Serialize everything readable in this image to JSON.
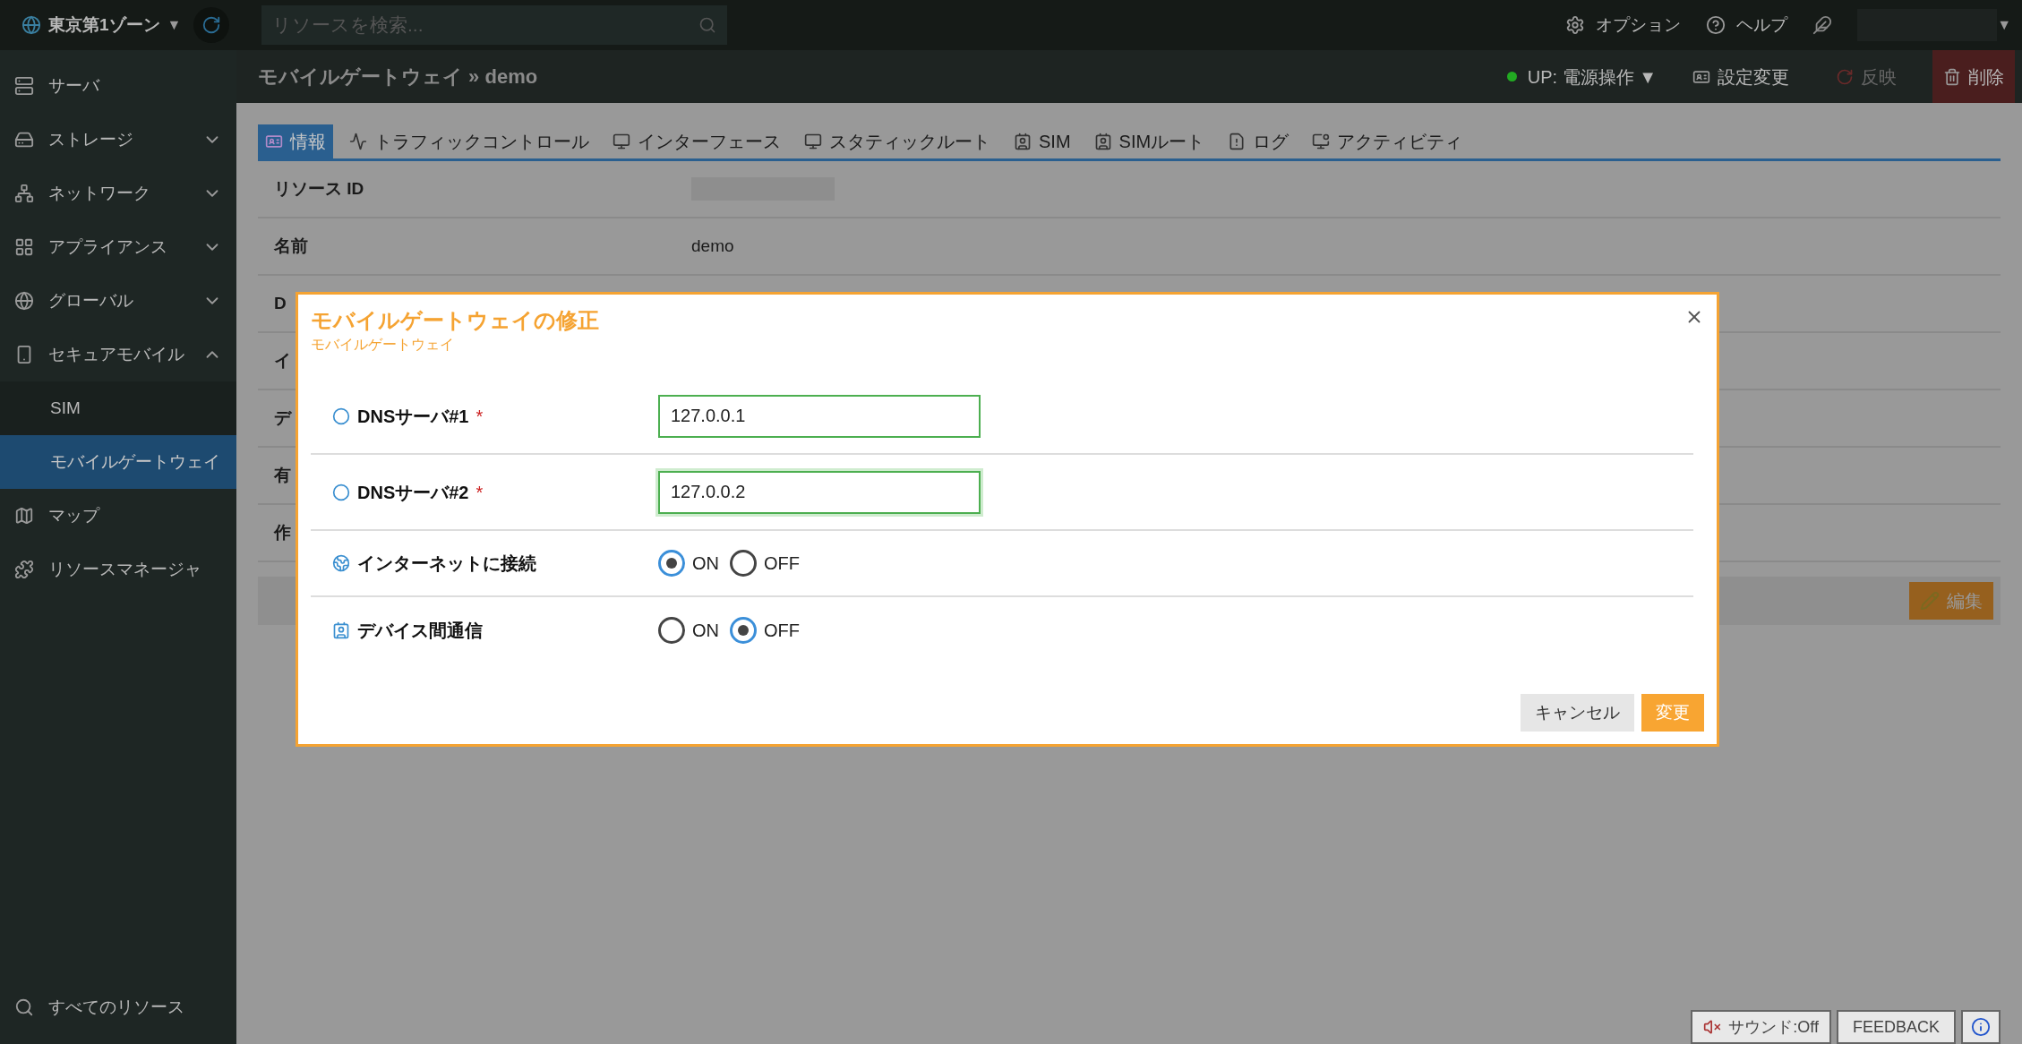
{
  "topbar": {
    "zone": "東京第1ゾーン",
    "zone_caret": "▼",
    "search": {
      "placeholder": "リソースを検索..."
    },
    "links": [
      {
        "label": "オプション"
      },
      {
        "label": "ヘルプ"
      }
    ],
    "user_caret": "▼"
  },
  "sidebar": {
    "items": [
      {
        "label": "サーバ"
      },
      {
        "label": "ストレージ",
        "expanded": false
      },
      {
        "label": "ネットワーク",
        "expanded": false
      },
      {
        "label": "アプライアンス",
        "expanded": false
      },
      {
        "label": "グローバル",
        "expanded": false
      },
      {
        "label": "セキュアモバイル",
        "expanded": true,
        "children": [
          {
            "label": "SIM",
            "selected": false
          },
          {
            "label": "モバイルゲートウェイ",
            "selected": true
          }
        ]
      },
      {
        "label": "マップ"
      },
      {
        "label": "リソースマネージャ"
      }
    ],
    "footer": "すべてのリソース"
  },
  "header": {
    "breadcrumb": "モバイルゲートウェイ » demo",
    "status": {
      "label": "UP: 電源操作 ▼",
      "color": "#22aa22"
    },
    "actions": [
      {
        "label": "設定変更",
        "disabled": false,
        "kind": "normal"
      },
      {
        "label": "反映",
        "disabled": true,
        "kind": "normal"
      },
      {
        "label": "削除",
        "disabled": false,
        "kind": "danger"
      }
    ]
  },
  "tabs": [
    {
      "label": "情報",
      "selected": true
    },
    {
      "label": "トラフィックコントロール",
      "selected": false
    },
    {
      "label": "インターフェース",
      "selected": false
    },
    {
      "label": "スタティックルート",
      "selected": false
    },
    {
      "label": "SIM",
      "selected": false
    },
    {
      "label": "SIMルート",
      "selected": false
    },
    {
      "label": "ログ",
      "selected": false
    },
    {
      "label": "アクティビティ",
      "selected": false
    }
  ],
  "details": [
    {
      "label": "リソース ID",
      "kind": "blurred"
    },
    {
      "label": "名前",
      "value": "demo"
    },
    {
      "label": "D"
    },
    {
      "label": "イ"
    },
    {
      "label": "デ"
    },
    {
      "label": "有"
    },
    {
      "label": "作"
    }
  ],
  "edit_button": "編集",
  "dialog": {
    "title": "モバイルゲートウェイの修正",
    "subtitle": "モバイルゲートウェイ",
    "fields": [
      {
        "kind": "text",
        "label": "DNSサーバ#1",
        "required_mark": "*",
        "value": "127.0.0.1",
        "focused": false
      },
      {
        "kind": "text",
        "label": "DNSサーバ#2",
        "required_mark": "*",
        "value": "127.0.0.2",
        "focused": true
      },
      {
        "kind": "radio",
        "label": "インターネットに接続",
        "options": [
          {
            "label": "ON",
            "selected": true
          },
          {
            "label": "OFF",
            "selected": false
          }
        ]
      },
      {
        "kind": "radio",
        "label": "デバイス間通信",
        "options": [
          {
            "label": "ON",
            "selected": false
          },
          {
            "label": "OFF",
            "selected": true
          }
        ]
      }
    ],
    "buttons": [
      {
        "label": "キャンセル",
        "kind": "secondary"
      },
      {
        "label": "変更",
        "kind": "primary"
      }
    ]
  },
  "footer": {
    "sound": "サウンド:Off",
    "feedback": "FEEDBACK"
  }
}
